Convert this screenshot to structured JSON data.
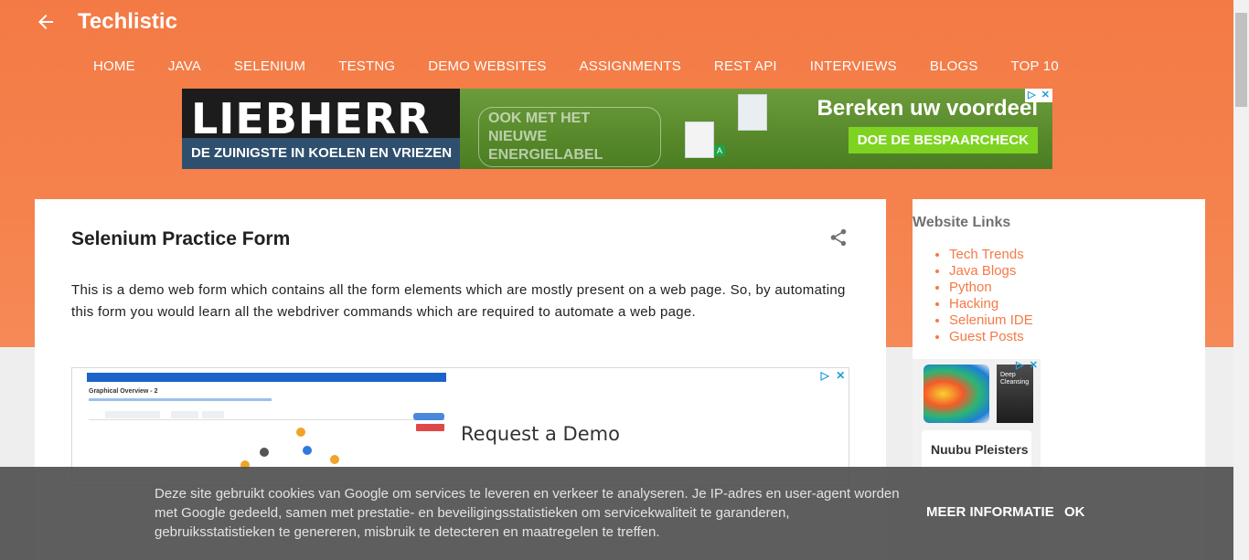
{
  "header": {
    "title": "Techlistic",
    "nav": [
      "HOME",
      "JAVA",
      "SELENIUM",
      "TESTNG",
      "DEMO WEBSITES",
      "ASSIGNMENTS",
      "REST API",
      "INTERVIEWS",
      "BLOGS",
      "TOP 10"
    ]
  },
  "banner_ad": {
    "brand": "LIEBHERR",
    "tagline": "DE ZUINIGSTE IN KOELEN EN VRIEZEN",
    "label": "OOK MET HET NIEUWE ENERGIELABEL",
    "energy_badge": "A",
    "headline": "Bereken uw voordeel",
    "cta": "DOE DE BESPAARCHECK",
    "adchoice": [
      "▷",
      "✕"
    ]
  },
  "post": {
    "title": "Selenium Practice Form",
    "body": "This is a demo web form which contains all the form elements which are mostly present on a web page. So, by automating this form you would learn all the webdriver commands which are required to automate a web page."
  },
  "demo_ad": {
    "screenshot_title": "Graphical Overview - 2",
    "headline": "Request a Demo",
    "adchoice": [
      "▷",
      "✕"
    ]
  },
  "sidebar": {
    "heading": "Website Links",
    "links": [
      "Tech Trends",
      "Java Blogs",
      "Python",
      "Hacking",
      "Selenium IDE",
      "Guest Posts"
    ],
    "ad": {
      "product_label": "Deep Cleansing",
      "name": "Nuubu Pleisters",
      "adchoice": [
        "▷",
        "✕"
      ]
    }
  },
  "cookie_bar": {
    "text": "Deze site gebruikt cookies van Google om services te leveren en verkeer te analyseren. Je IP-adres en user-agent worden met Google gedeeld, samen met prestatie- en beveiligingsstatistieken om servicekwaliteit te garanderen, gebruiksstatistieken te genereren, misbruik te detecteren en maatregelen te treffen.",
    "more_info": "MEER INFORMATIE",
    "ok": "OK"
  },
  "colors": {
    "accent": "#f47a45",
    "link": "#f47a45",
    "cookie_bg": "#505050"
  }
}
